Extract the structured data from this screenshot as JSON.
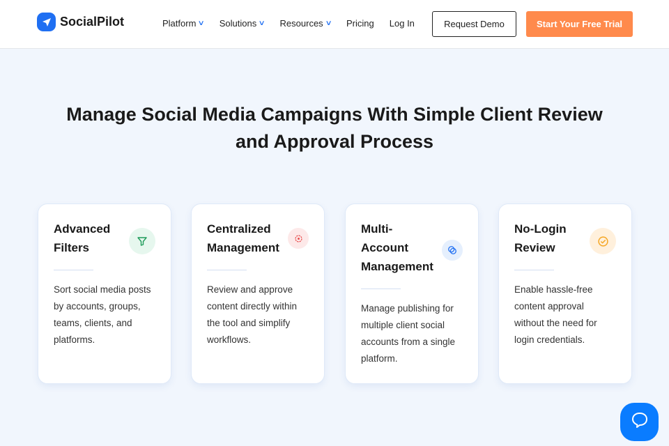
{
  "header": {
    "brand": "SocialPilot",
    "nav": [
      {
        "label": "Platform",
        "dropdown": true
      },
      {
        "label": "Solutions",
        "dropdown": true
      },
      {
        "label": "Resources",
        "dropdown": true
      },
      {
        "label": "Pricing",
        "dropdown": false
      },
      {
        "label": "Log In",
        "dropdown": false
      }
    ],
    "request_demo": "Request Demo",
    "free_trial": "Start Your Free Trial"
  },
  "main": {
    "title_line1": "Manage Social Media Campaigns With Simple Client Review",
    "title_line2": "and Approval Process",
    "cards": [
      {
        "title": "Advanced Filters",
        "icon": "filter-icon",
        "text": "Sort social media posts by accounts, groups, teams, clients, and platforms."
      },
      {
        "title": "Centralized Management",
        "icon": "gear-icon",
        "text": "Review and approve content directly within the tool and simplify workflows."
      },
      {
        "title": "Multi-Account Management",
        "icon": "accounts-icon",
        "text": "Manage publishing for multiple client social accounts from a single platform."
      },
      {
        "title": "No-Login Review",
        "icon": "check-badge-icon",
        "text": "Enable hassle-free content approval without the need for login credentials."
      }
    ]
  },
  "colors": {
    "brand": "#1f6ff2",
    "cta": "#ff8a4c",
    "background": "#f1f6fd"
  }
}
